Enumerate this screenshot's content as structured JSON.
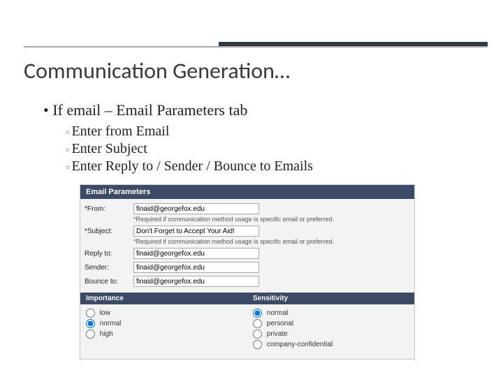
{
  "title": "Communication Generation…",
  "bullet1": "If email – Email Parameters tab",
  "sub": {
    "a": "Enter from Email",
    "b": "Enter Subject",
    "c": "Enter Reply to / Sender / Bounce to Emails"
  },
  "panel": {
    "header": "Email Parameters",
    "from_label": "*From:",
    "from_value": "finaid@georgefox.edu",
    "from_hint": "*Required if communication method usage is specific email or preferred.",
    "subject_label": "*Subject:",
    "subject_value": "Don't Forget to Accept Your Aid!",
    "subject_hint": "*Required if communication method usage is specific email or preferred.",
    "reply_label": "Reply to:",
    "reply_value": "finaid@georgefox.edu",
    "sender_label": "Sender:",
    "sender_value": "finaid@georgefox.edu",
    "bounce_label": "Bounce to:",
    "bounce_value": "finaid@georgefox.edu"
  },
  "importance": {
    "header": "Importance",
    "low": "low",
    "normal": "normal",
    "high": "high"
  },
  "sensitivity": {
    "header": "Sensitivity",
    "normal": "normal",
    "personal": "personal",
    "private": "private",
    "company": "company-confidential"
  }
}
